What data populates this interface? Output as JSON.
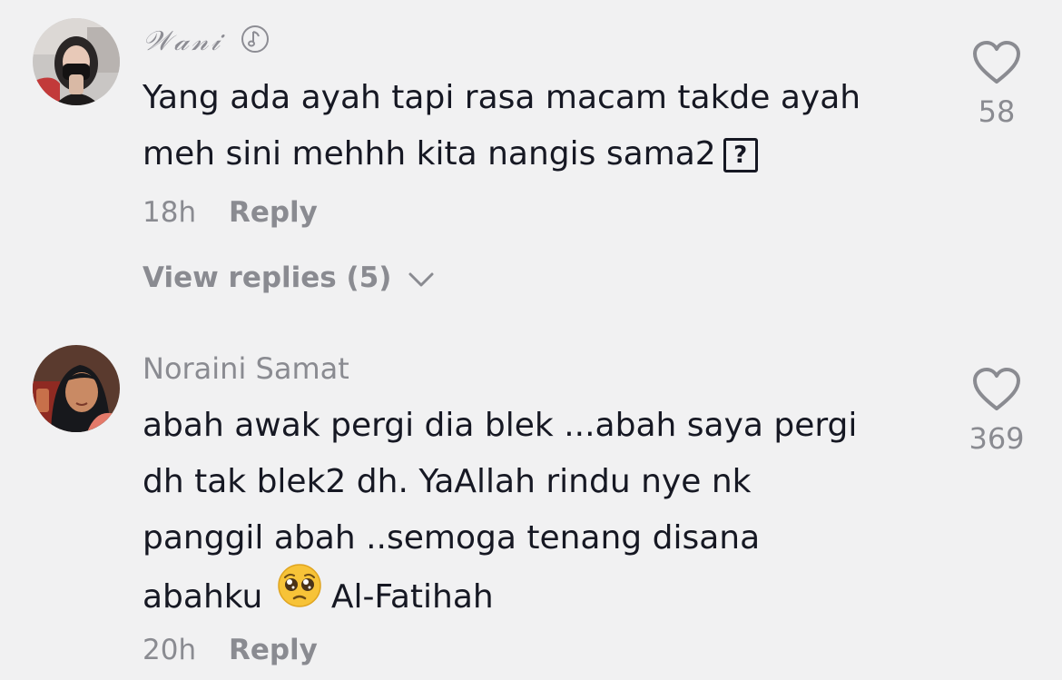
{
  "comments": [
    {
      "username": "𝒲𝒶𝓃𝒾",
      "username_icon": "music-note-circle-icon",
      "text_lines": [
        "Yang ada ayah tapi rasa macam takde ayah",
        "meh sini mehhh kita nangis sama2"
      ],
      "unknown_glyph": "?",
      "time": "18h",
      "reply_label": "Reply",
      "view_replies_label": "View replies (5)",
      "likes": "58",
      "like_icon": "heart-outline-icon"
    },
    {
      "username": "Noraini Samat",
      "text_lines": [
        "abah awak pergi dia blek ...abah saya pergi",
        "dh tak blek2 dh. YaAllah rindu nye nk",
        "panggil abah ..semoga tenang disana"
      ],
      "last_line_before_emoji": "abahku",
      "emoji": "pleading-face-emoji",
      "last_line_after_emoji": "Al-Fatihah",
      "time": "20h",
      "reply_label": "Reply",
      "likes": "369",
      "like_icon": "heart-outline-icon"
    }
  ],
  "colors": {
    "background": "#f1f1f2",
    "text": "#161823",
    "muted": "#8a8b91"
  }
}
